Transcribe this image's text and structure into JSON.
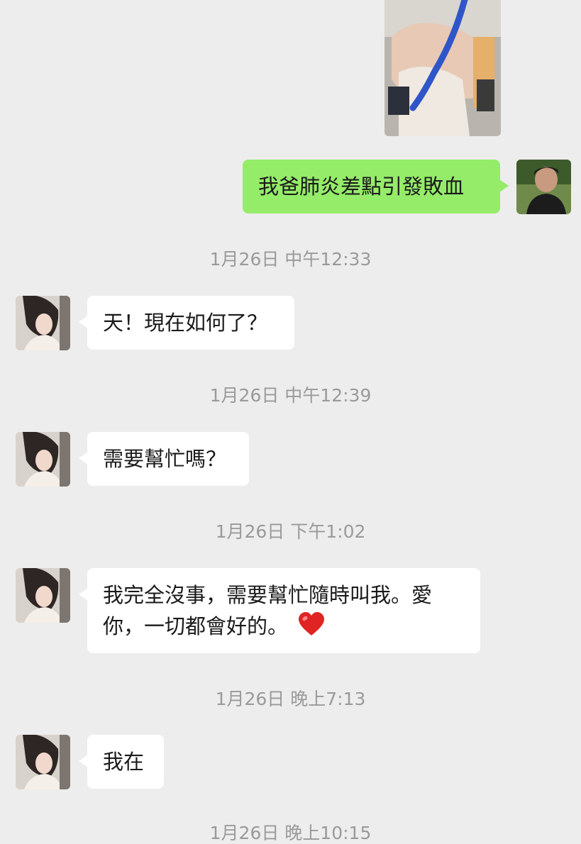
{
  "messages": [
    {
      "id": "m1",
      "side": "out",
      "type": "image",
      "image": "hospital-bed-photo"
    },
    {
      "id": "m2",
      "side": "out",
      "type": "text",
      "text": "我爸肺炎差點引發敗血"
    },
    {
      "id": "m3",
      "side": "in",
      "timestamp": "1月26日 中午12:33",
      "text": "天！現在如何了？"
    },
    {
      "id": "m4",
      "side": "in",
      "timestamp": "1月26日 中午12:39",
      "text": "需要幫忙嗎？"
    },
    {
      "id": "m5",
      "side": "in",
      "timestamp": "1月26日 下午1:02",
      "text_line1": "我完全沒事，需要幫忙隨時叫我。愛",
      "text_line2": "你，一切都會好的。",
      "emoji": "red-heart"
    },
    {
      "id": "m6",
      "side": "in",
      "timestamp": "1月26日 晚上7:13",
      "text": "我在"
    }
  ],
  "last_timestamp": "1月26日 晚上10:15",
  "colors": {
    "background": "#ededed",
    "outgoing_bubble": "#95ec69",
    "incoming_bubble": "#ffffff",
    "timestamp": "#9a9a9a"
  }
}
